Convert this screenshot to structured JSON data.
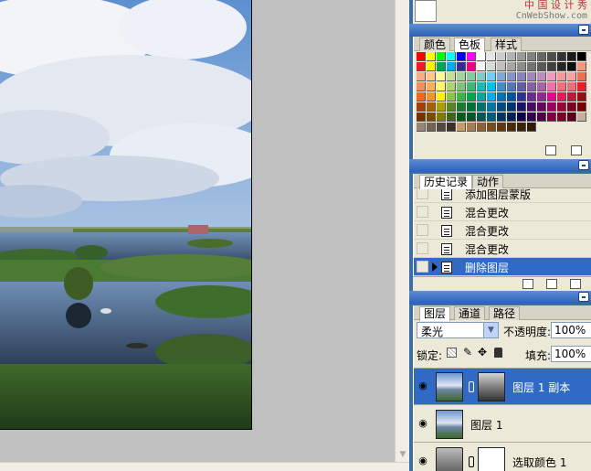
{
  "watermark": {
    "line1": "中 国 设 计 秀",
    "line2": "CnWebShow.com"
  },
  "swatch_colors": [
    "#ff0000",
    "#ffff00",
    "#00ff00",
    "#00ffff",
    "#0000ff",
    "#ff00ff",
    "#ffffff",
    "#e6e6e6",
    "#cccccc",
    "#b3b3b3",
    "#999999",
    "#808080",
    "#666666",
    "#4d4d4d",
    "#333333",
    "#1a1a1a",
    "#000000",
    "#ed1c24",
    "#fff200",
    "#00a651",
    "#00aeef",
    "#2e3192",
    "#ec008c",
    "#f2f2f2",
    "#d9d9d9",
    "#bfbfbf",
    "#a6a6a6",
    "#8c8c8c",
    "#737373",
    "#595959",
    "#404040",
    "#262626",
    "#0d0d0d",
    "#f7977a",
    "#f9ad81",
    "#fdc68a",
    "#fff79a",
    "#c4df9b",
    "#a2d39c",
    "#82ca9d",
    "#7bcdc8",
    "#6ecff6",
    "#7ea7d8",
    "#8493ca",
    "#8882be",
    "#a187be",
    "#bc8dbf",
    "#f49ac2",
    "#f6989d",
    "#f5a3a3",
    "#f26c4f",
    "#f68e55",
    "#fbaf5c",
    "#fff467",
    "#acd372",
    "#7cc576",
    "#3bb878",
    "#1abbb4",
    "#00bff3",
    "#438ccb",
    "#5574b9",
    "#605ca8",
    "#855fa8",
    "#a763a8",
    "#f06ea9",
    "#f26d7d",
    "#e8707a",
    "#ed1c24",
    "#f26522",
    "#f7941d",
    "#fff200",
    "#8dc63f",
    "#39b54a",
    "#00a651",
    "#00a99d",
    "#00aeef",
    "#0072bc",
    "#0054a6",
    "#2e3192",
    "#662d91",
    "#92278f",
    "#ec008c",
    "#ed145b",
    "#c4143c",
    "#9e0b0f",
    "#a0410d",
    "#a36209",
    "#aba000",
    "#598527",
    "#197b30",
    "#007236",
    "#00746b",
    "#0076a3",
    "#004b80",
    "#003471",
    "#1b1464",
    "#440e62",
    "#630460",
    "#9e005d",
    "#9e0039",
    "#7a0026",
    "#790000",
    "#7b2e00",
    "#7d4900",
    "#827b00",
    "#406618",
    "#005e20",
    "#005826",
    "#005952",
    "#005b7f",
    "#003663",
    "#002157",
    "#0d004c",
    "#32004b",
    "#4b0049",
    "#7b0046",
    "#7a0026",
    "#5a001a",
    "#c7b299",
    "#998675",
    "#736357",
    "#534741",
    "#37302d",
    "#c69c6d",
    "#a67c52",
    "#8c6239",
    "#754c24",
    "#603913",
    "#4a2a0e",
    "#3b220b",
    "#2e1a08"
  ],
  "swatches_tabs": [
    "颜色",
    "色板",
    "样式"
  ],
  "history_tabs": [
    "历史记录",
    "动作"
  ],
  "history_items": [
    {
      "label": "添加图层蒙版",
      "selected": false
    },
    {
      "label": "混合更改",
      "selected": false
    },
    {
      "label": "混合更改",
      "selected": false
    },
    {
      "label": "混合更改",
      "selected": false
    },
    {
      "label": "删除图层",
      "selected": true
    }
  ],
  "layers_tabs": [
    "图层",
    "通道",
    "路径"
  ],
  "blend_mode": "柔光",
  "opacity_label": "不透明度:",
  "opacity_value": "100%",
  "lock_label": "锁定:",
  "fill_label": "填充:",
  "fill_value": "100%",
  "layers": [
    {
      "name": "图层 1 副本",
      "selected": true
    },
    {
      "name": "图层 1",
      "selected": false
    },
    {
      "name": "选取颜色 1",
      "selected": false
    }
  ]
}
